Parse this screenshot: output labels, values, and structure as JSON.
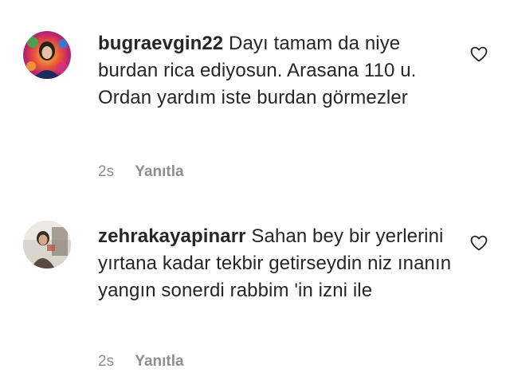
{
  "comments": [
    {
      "username": "bugraevgin22",
      "text": "Dayı tamam da niye burdan rica ediyosun. Arasana 110 u. Ordan yardım iste burdan görmezler",
      "time": "2s",
      "reply_label": "Yanıtla",
      "avatar_icon": "user-avatar-colorful",
      "like_icon": "heart-outline-icon"
    },
    {
      "username": "zehrakayapinarr",
      "text": "Sahan bey bir yerlerini yırtana kadar tekbir getirseydin niz ınanın yangın sonerdi rabbim 'in izni ile",
      "time": "2s",
      "reply_label": "Yanıtla",
      "avatar_icon": "user-avatar-photo",
      "like_icon": "heart-outline-icon"
    }
  ],
  "colors": {
    "text": "#262626",
    "muted": "#8e8e8e",
    "background": "#ffffff"
  }
}
